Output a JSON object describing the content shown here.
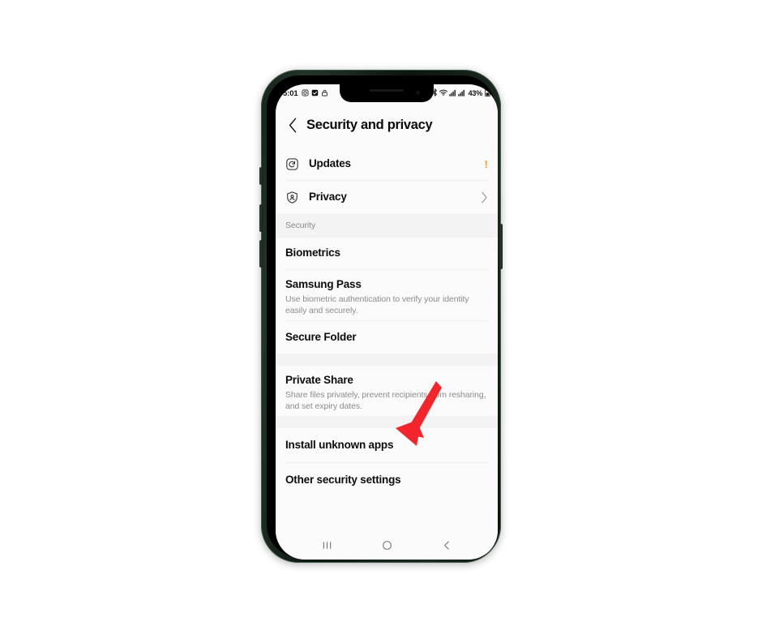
{
  "status_bar": {
    "time": "5:01",
    "left_icons": [
      "camera-icon",
      "checkbox-icon",
      "lock-icon"
    ],
    "right_icons": [
      "bluetooth-icon",
      "wifi-icon",
      "signal-bars-icon",
      "signal-bars-icon"
    ],
    "battery_percent": "43%",
    "battery_icon": "battery-icon"
  },
  "header": {
    "back_icon": "chevron-left-icon",
    "title": "Security and privacy"
  },
  "list": [
    {
      "id": "updates",
      "icon": "software-update-icon",
      "title": "Updates",
      "desc": null,
      "trailing": "alert-badge",
      "trailing_text": "!"
    },
    {
      "id": "privacy",
      "icon": "shield-person-icon",
      "title": "Privacy",
      "desc": null,
      "trailing": "chevron-right-icon",
      "trailing_text": ""
    }
  ],
  "section_security": {
    "label": "Security",
    "items": [
      {
        "id": "biometrics",
        "title": "Biometrics",
        "desc": null
      },
      {
        "id": "samsung-pass",
        "title": "Samsung Pass",
        "desc": "Use biometric authentication to verify your identity easily and securely."
      },
      {
        "id": "secure-folder",
        "title": "Secure Folder",
        "desc": null
      }
    ]
  },
  "group_private": {
    "items": [
      {
        "id": "private-share",
        "title": "Private Share",
        "desc": "Share files privately, prevent recipients from resharing, and set expiry dates."
      }
    ]
  },
  "group_install": {
    "items": [
      {
        "id": "install-unknown-apps",
        "title": "Install unknown apps",
        "desc": null
      },
      {
        "id": "other-security-settings",
        "title": "Other security settings",
        "desc": null
      }
    ]
  },
  "nav_bar": {
    "recents_icon": "recents-icon",
    "home_icon": "home-icon",
    "back_icon": "back-icon"
  },
  "annotation": {
    "arrow_icon": "red-arrow-down-left-icon",
    "arrow_color": "#f3252b",
    "points_to": "install-unknown-apps"
  },
  "colors": {
    "accent_alert": "#f0a20c",
    "annotation_red": "#f3252b",
    "screen_background": "#fbfbfb",
    "group_gap": "#f3f3f3",
    "frame": "#16261b"
  }
}
